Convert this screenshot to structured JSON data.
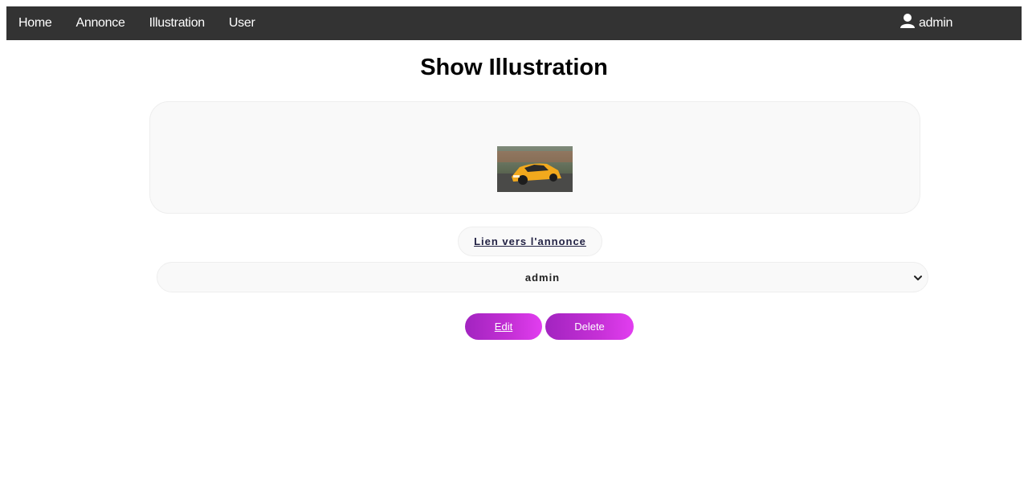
{
  "nav": {
    "links": [
      "Home",
      "Annonce",
      "Illustration",
      "User"
    ],
    "user_label": "admin"
  },
  "page": {
    "title": "Show Illustration"
  },
  "illustration": {
    "link_label": "Lien vers l'annonce",
    "selected_user": "admin"
  },
  "actions": {
    "edit_label": "Edit",
    "delete_label": "Delete"
  },
  "colors": {
    "navbar_bg": "#333333",
    "button_gradient_start": "#a224c0",
    "button_gradient_end": "#e23ef0",
    "card_bg": "#f9f9f9"
  },
  "icons": {
    "user": "user-icon",
    "chevron": "chevron-down-icon"
  }
}
